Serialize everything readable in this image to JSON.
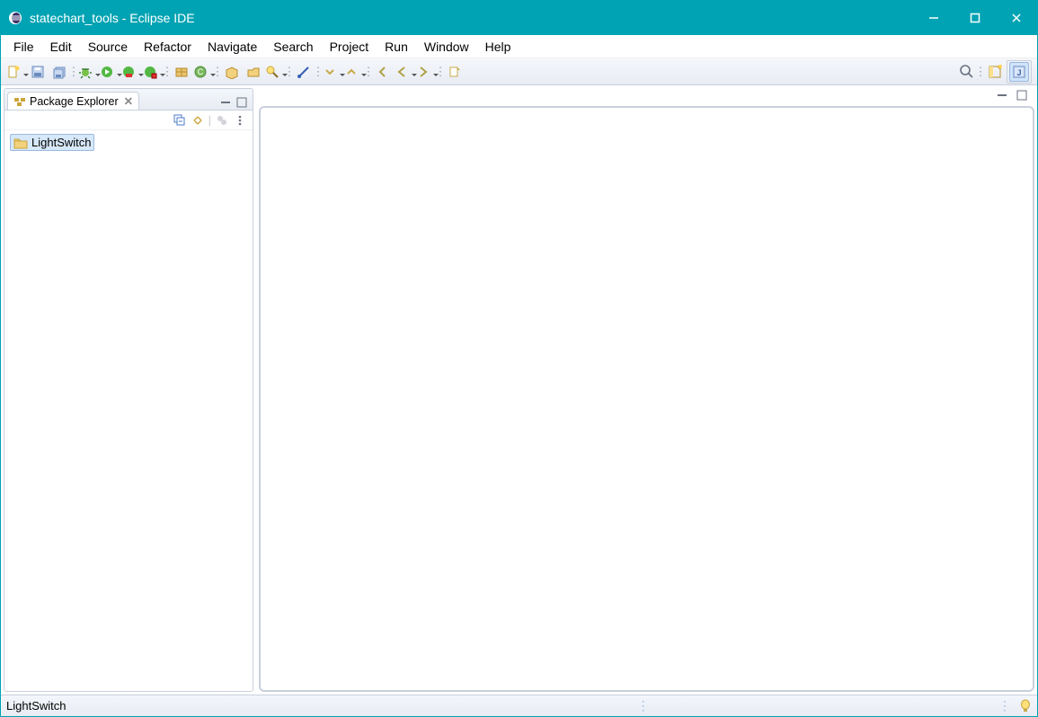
{
  "window": {
    "title": "statechart_tools - Eclipse IDE"
  },
  "menubar": {
    "file": "File",
    "edit": "Edit",
    "source": "Source",
    "refactor": "Refactor",
    "navigate": "Navigate",
    "search": "Search",
    "project": "Project",
    "run": "Run",
    "window": "Window",
    "help": "Help"
  },
  "sidebar": {
    "view_title": "Package Explorer",
    "project": {
      "name": "LightSwitch"
    }
  },
  "statusbar": {
    "selection": "LightSwitch"
  }
}
